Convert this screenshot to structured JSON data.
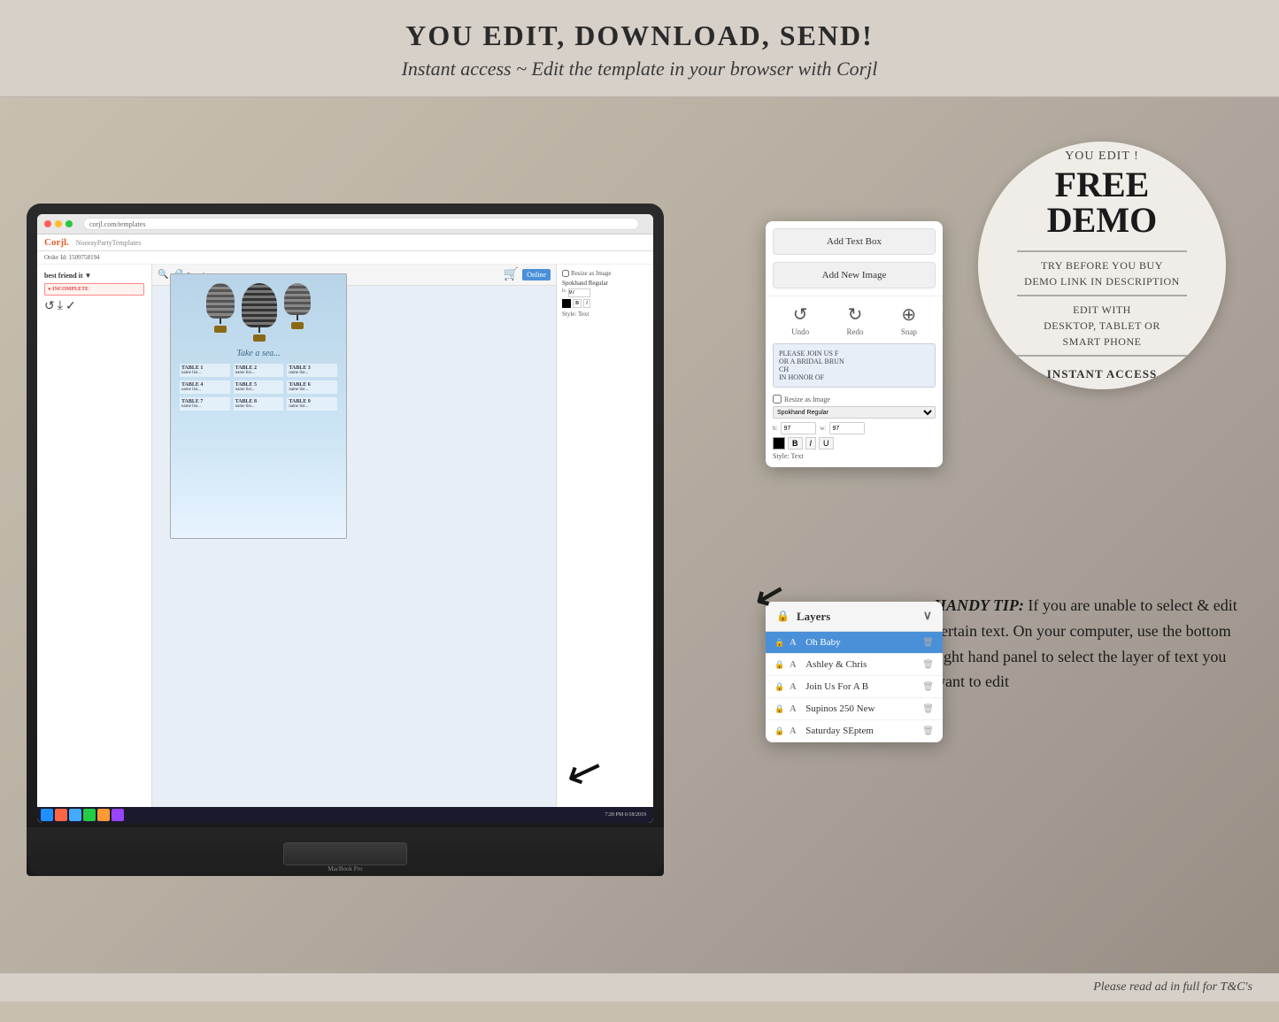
{
  "header": {
    "main_title": "YOU EDIT, DOWNLOAD, SEND!",
    "sub_title": "Instant access ~ Edit the template in your browser with Corjl"
  },
  "free_demo": {
    "you_edit": "YOU EDIT !",
    "free": "FREE",
    "demo": "DEMO",
    "try_before": "TRY BEFORE YOU BUY",
    "demo_link": "DEMO LINK IN DESCRIPTION",
    "edit_with": "EDIT WITH",
    "devices": "DESKTOP, TABLET OR",
    "smartphone": "SMART PHONE",
    "instant_access": "INSTANT ACCESS"
  },
  "corjl_panel": {
    "add_text_box": "Add Text Box",
    "add_new_image": "Add New Image",
    "undo_label": "Undo",
    "redo_label": "Redo",
    "snap_label": "Snap",
    "text_content": "PLEASE JOIN US F\nOR A BRIDAL BRUN\nCH\nIN HONOR OF",
    "font_label": "Spokhand Regular",
    "style_label": "Style: Text"
  },
  "layers_panel": {
    "title": "Layers",
    "chevron": "∨",
    "items": [
      {
        "name": "Oh Baby",
        "type": "A",
        "active": true
      },
      {
        "name": "Ashley & Chris",
        "type": "A",
        "active": false
      },
      {
        "name": "Join Us For A B",
        "type": "A",
        "active": false
      },
      {
        "name": "Supinos 250 New",
        "type": "A",
        "active": false
      },
      {
        "name": "Saturday SEptem",
        "type": "A",
        "active": false
      }
    ]
  },
  "handy_tip": {
    "label": "HANDY TIP:",
    "text": " If you are unable to select & edit certain text. On your computer, use the bottom right hand panel to select the layer of text you want to edit"
  },
  "browser": {
    "url": "corjl.com/templates",
    "logo": "Corjl."
  },
  "laptop": {
    "brand": "MacBook Pro"
  },
  "footer": {
    "disclaimer": "Please read ad in full for T&C's"
  },
  "taskbar": {
    "time": "7:20 PM\n6/18/2019"
  }
}
